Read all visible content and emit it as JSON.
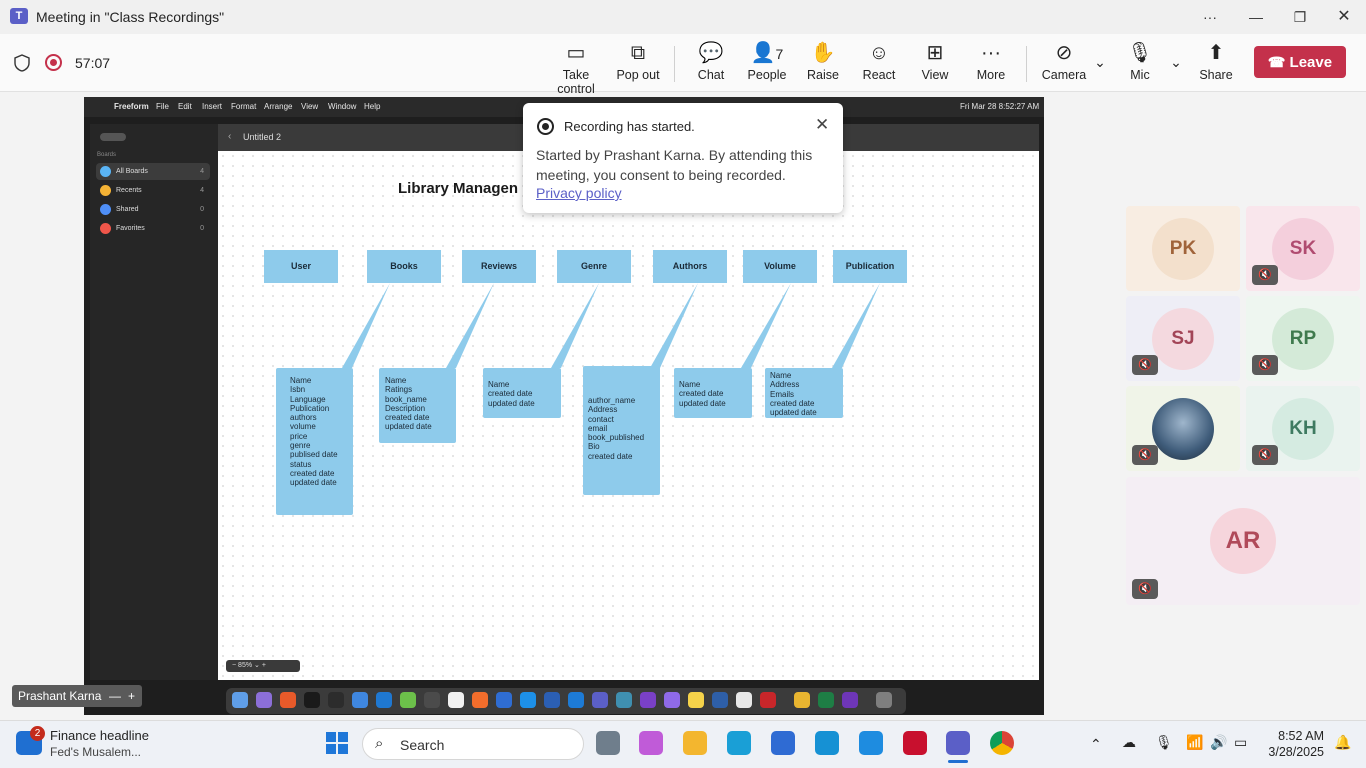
{
  "window": {
    "title": "Meeting in \"Class Recordings\"",
    "app_icon": "T",
    "minimize": "—",
    "maximize": "❐",
    "close": "✕",
    "more": "···"
  },
  "toolbar": {
    "timer": "57:07",
    "take_control": "Take control",
    "pop_out": "Pop out",
    "chat": "Chat",
    "people": "People",
    "people_count": "7",
    "raise": "Raise",
    "react": "React",
    "view": "View",
    "more": "More",
    "camera": "Camera",
    "mic": "Mic",
    "share": "Share",
    "leave": "Leave"
  },
  "mac_menubar": {
    "app": "Freeform",
    "menus": [
      "File",
      "Edit",
      "Insert",
      "Format",
      "Arrange",
      "View",
      "Window",
      "Help"
    ],
    "clock": "Fri Mar 28 8:52:27 AM"
  },
  "freeform": {
    "sidebar_heading": "Boards",
    "sidebar": [
      {
        "label": "All Boards",
        "count": "4",
        "color": "#5ab4f5"
      },
      {
        "label": "Recents",
        "count": "4",
        "color": "#f5b335"
      },
      {
        "label": "Shared",
        "count": "0",
        "color": "#4f8ff7"
      },
      {
        "label": "Favorites",
        "count": "0",
        "color": "#f0564a"
      }
    ],
    "board_title": "Untitled 2",
    "canvas_title": "Library Managen",
    "zoom": "85%",
    "entities": [
      "User",
      "Books",
      "Reviews",
      "Genre",
      "Authors",
      "Volume",
      "Publication"
    ],
    "notes": [
      [
        "Name",
        "Isbn",
        "Language",
        "Publication",
        "authors",
        "volume",
        "price",
        "genre",
        "publised date",
        "status",
        "created date",
        "updated date"
      ],
      [
        "Name",
        "Ratings",
        "book_name",
        "Description",
        "created date",
        "updated date"
      ],
      [
        "Name",
        "created date",
        "updated date"
      ],
      [
        "author_name",
        "Address",
        "contact",
        "email",
        "book_published",
        "Bio",
        "created date"
      ],
      [
        "Name",
        "created date",
        "updated date"
      ],
      [
        "Name",
        "Address",
        "Emails",
        "created date",
        "updated date"
      ]
    ]
  },
  "toast": {
    "title": "Recording has started.",
    "body": "Started by Prashant Karna. By attending this meeting, you consent to being recorded.",
    "link": "Privacy policy"
  },
  "presenter_label": "Prashant Karna",
  "participants": [
    {
      "initials": "PK",
      "muted": false,
      "bg": "#f8ede2",
      "avatar_bg": "#f3e0cc",
      "fg": "#a0643a"
    },
    {
      "initials": "SK",
      "muted": true,
      "bg": "#f9e6ec",
      "avatar_bg": "#f4cfdc",
      "fg": "#b04b70"
    },
    {
      "initials": "SJ",
      "muted": true,
      "bg": "#eeeef6",
      "avatar_bg": "#f4d9df",
      "fg": "#a24557"
    },
    {
      "initials": "RP",
      "muted": true,
      "bg": "#eef6f0",
      "avatar_bg": "#d4ead8",
      "fg": "#3f7a4d"
    },
    {
      "initials": "",
      "muted": true,
      "bg": "#f0f4e8",
      "avatar_bg": "#3f5c7a",
      "fg": "#ffffff"
    },
    {
      "initials": "KH",
      "muted": true,
      "bg": "#eaf3ef",
      "avatar_bg": "#d5ebe1",
      "fg": "#3e7a60"
    },
    {
      "initials": "AR",
      "muted": true,
      "bg": "#f4eef4",
      "avatar_bg": "#f6d5dc",
      "fg": "#b04a5a"
    }
  ],
  "taskbar": {
    "news_badge": "2",
    "news_title": "Finance headline",
    "news_sub": "Fed's Musalem...",
    "search_placeholder": "Search",
    "time": "8:52 AM",
    "date": "3/28/2025"
  }
}
